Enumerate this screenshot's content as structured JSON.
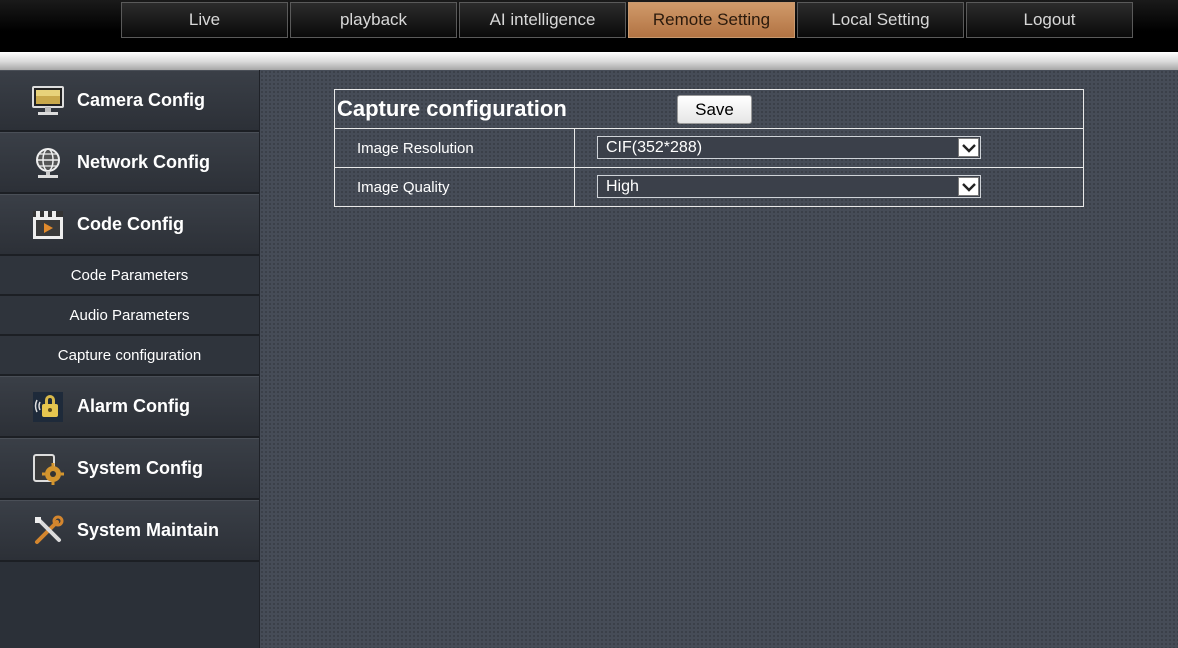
{
  "nav": {
    "items": [
      {
        "label": "Live"
      },
      {
        "label": "playback"
      },
      {
        "label": "AI intelligence"
      },
      {
        "label": "Remote Setting"
      },
      {
        "label": "Local Setting"
      },
      {
        "label": "Logout"
      }
    ],
    "active": "Remote Setting"
  },
  "sidebar": {
    "camera_config": "Camera Config",
    "network_config": "Network Config",
    "code_config": "Code Config",
    "sub_items": [
      {
        "label": "Code Parameters"
      },
      {
        "label": "Audio Parameters"
      },
      {
        "label": "Capture configuration"
      }
    ],
    "alarm_config": "Alarm Config",
    "system_config": "System Config",
    "system_maintain": "System Maintain"
  },
  "panel": {
    "title": "Capture configuration",
    "save_label": "Save",
    "fields": [
      {
        "label": "Image Resolution",
        "value": "CIF(352*288)"
      },
      {
        "label": "Image Quality",
        "value": "High"
      }
    ]
  },
  "colors": {
    "accent_active_tab": "#c1875a",
    "content_bg": "#464c57",
    "sidebar_bg": "#2b3038"
  }
}
